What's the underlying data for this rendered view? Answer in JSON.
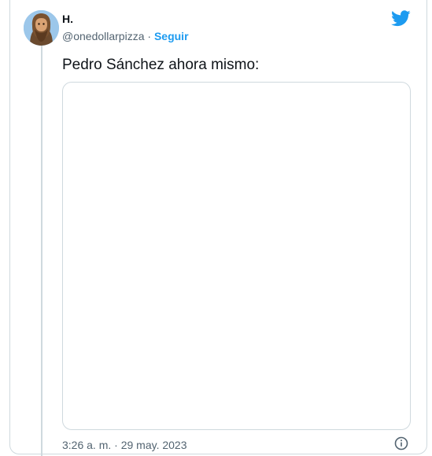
{
  "author": {
    "name": "H.",
    "handle": "@onedollarpizza",
    "separator": " · ",
    "follow_label": "Seguir"
  },
  "tweet": {
    "text": "Pedro Sánchez ahora mismo:",
    "timestamp": "3:26 a. m. · 29 may. 2023"
  },
  "icons": {
    "brand": "twitter-bird-icon",
    "info": "info-icon"
  },
  "colors": {
    "accent": "#1d9bf0",
    "secondary_text": "#536471",
    "border": "#cfd9de"
  }
}
